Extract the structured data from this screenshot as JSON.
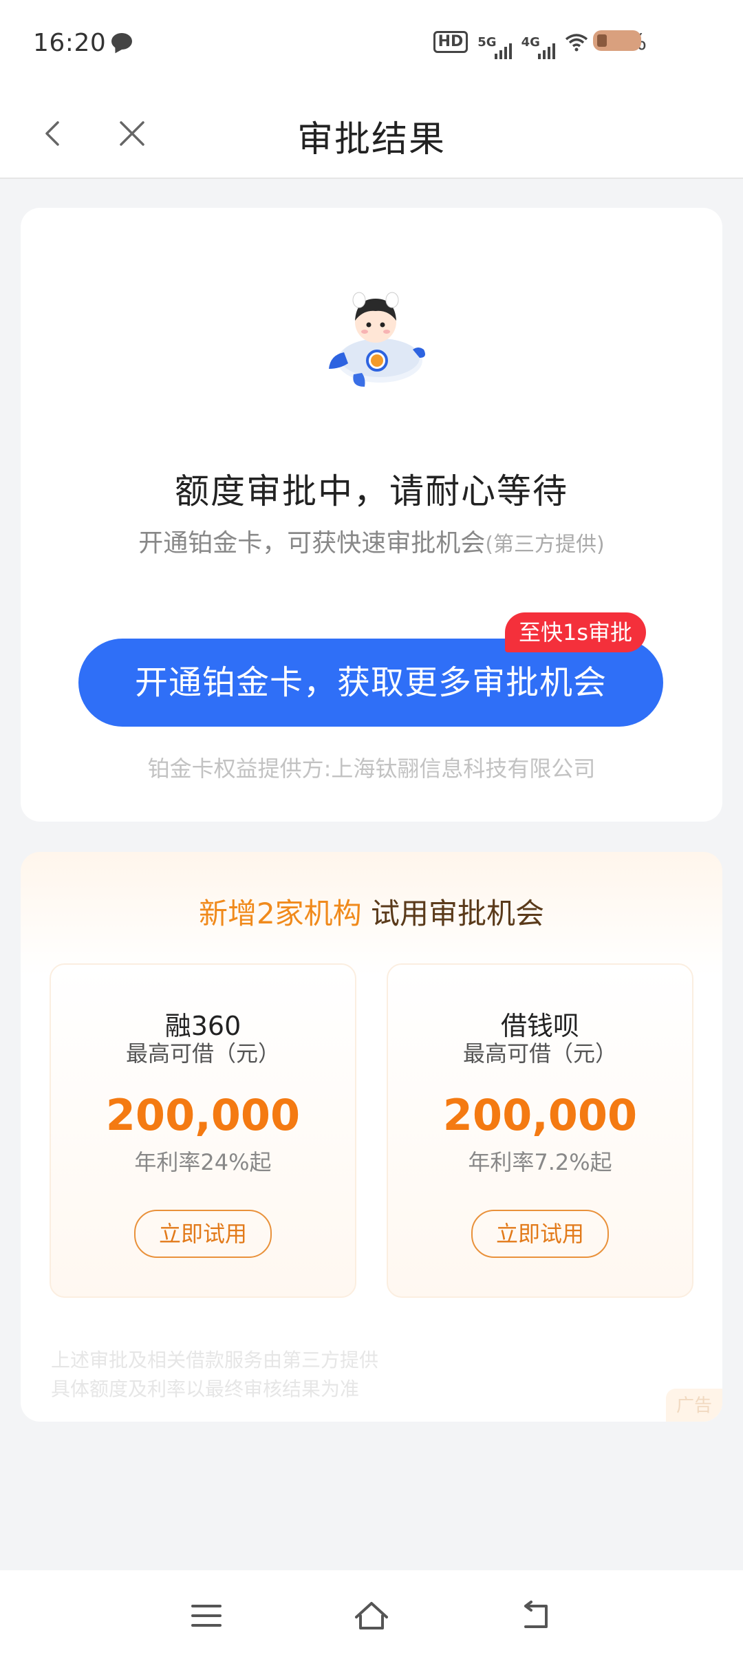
{
  "status_bar": {
    "time": "16:20",
    "hd": "HD",
    "net1": "5G",
    "net2": "4G",
    "battery": "16%"
  },
  "header": {
    "title": "审批结果"
  },
  "approval": {
    "title": "额度审批中，请耐心等待",
    "subtitle": "开通铂金卡，可获快速审批机会",
    "subtitle_note": "(第三方提供)",
    "cta_label": "开通铂金卡，获取更多审批机会",
    "cta_badge": "至快1s审批",
    "provider": "铂金卡权益提供方:上海钛翮信息科技有限公司"
  },
  "promo": {
    "title_highlight": "新增2家机构",
    "title_rest": "试用审批机会",
    "lenders": [
      {
        "name": "融360",
        "label": "最高可借（元）",
        "amount": "200,000",
        "rate": "年利率24%起",
        "button": "立即试用"
      },
      {
        "name": "借钱呗",
        "label": "最高可借（元）",
        "amount": "200,000",
        "rate": "年利率7.2%起",
        "button": "立即试用"
      }
    ],
    "disclaimer_line1": "上述审批及相关借款服务由第三方提供",
    "disclaimer_line2": "具体额度及利率以最终审核结果为准",
    "ad_label": "广告"
  },
  "colors": {
    "primary": "#2f6ff7",
    "badge": "#f4303b",
    "orange": "#f47a12"
  }
}
